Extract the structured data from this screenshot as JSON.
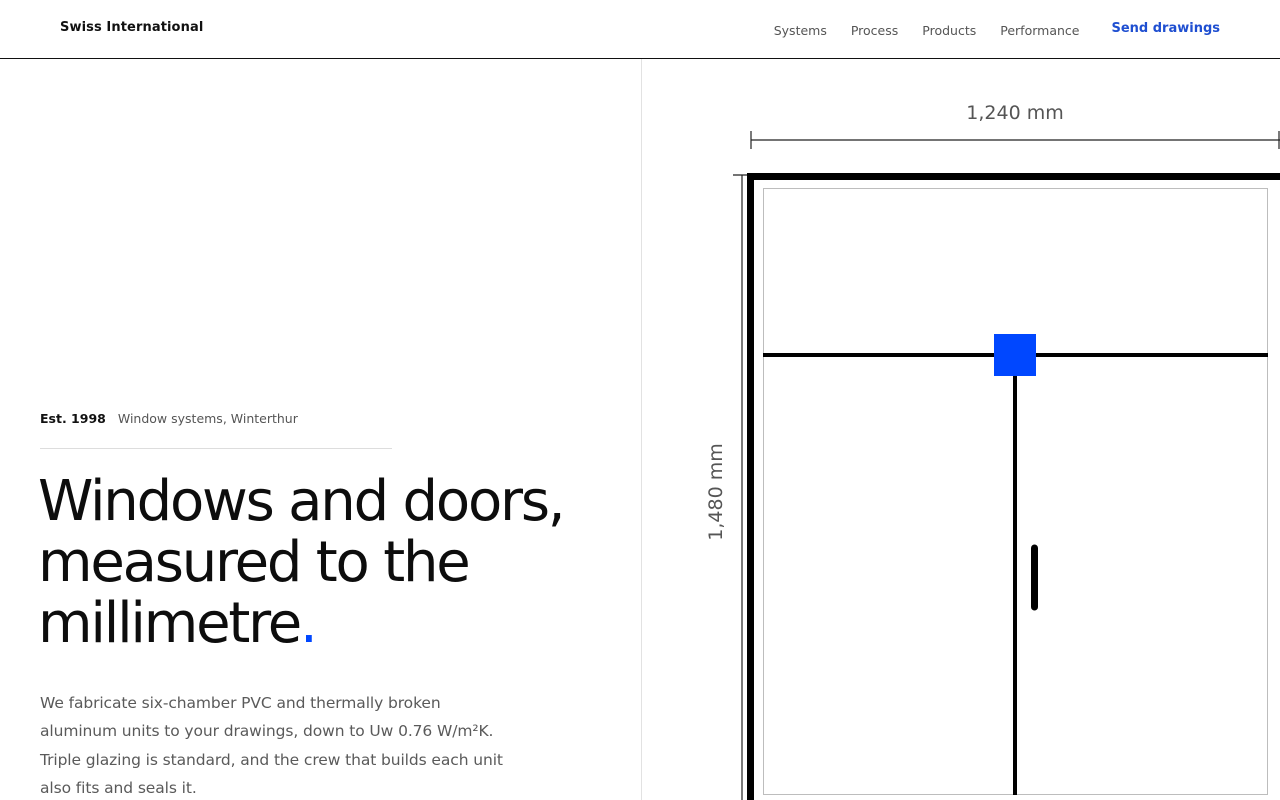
{
  "header": {
    "brand": "Swiss International",
    "nav": [
      "Systems",
      "Process",
      "Products",
      "Performance"
    ],
    "cta": "Send drawings"
  },
  "hero": {
    "established": "Est. 1998",
    "location": "Window systems, Winterthur",
    "headline_line1": "Windows and doors,",
    "headline_line2": "measured to the",
    "headline_line3": "millimetre",
    "headline_dot": ".",
    "lede": "We fabricate six-chamber PVC and thermally broken aluminum units to your drawings, down to Uw 0.76 W/m²K. Triple glazing is standard, and the crew that builds each unit also fits and seals it."
  },
  "drawing": {
    "width_label": "1,240 mm",
    "height_label": "1,480 mm",
    "accent_color": "#0047ff"
  },
  "colors": {
    "accent": "#0047ff",
    "cta": "#1f4fd1"
  }
}
